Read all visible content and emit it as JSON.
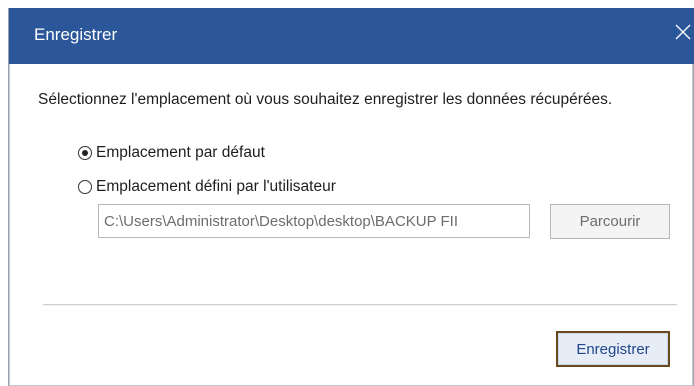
{
  "window": {
    "title": "Enregistrer"
  },
  "dialog": {
    "instruction": "Sélectionnez l'emplacement où vous souhaitez enregistrer les données récupérées.",
    "options": [
      {
        "label": "Emplacement par défaut",
        "selected": true
      },
      {
        "label": "Emplacement défini par l'utilisateur",
        "selected": false
      }
    ],
    "path_value": "C:\\Users\\Administrator\\Desktop\\desktop\\BACKUP FII",
    "browse_label": "Parcourir",
    "save_label": "Enregistrer"
  },
  "colors": {
    "titlebar": "#2b579a",
    "save_border": "#6a4a1c",
    "save_text": "#23468c"
  },
  "icons": {
    "close": "close-icon"
  }
}
